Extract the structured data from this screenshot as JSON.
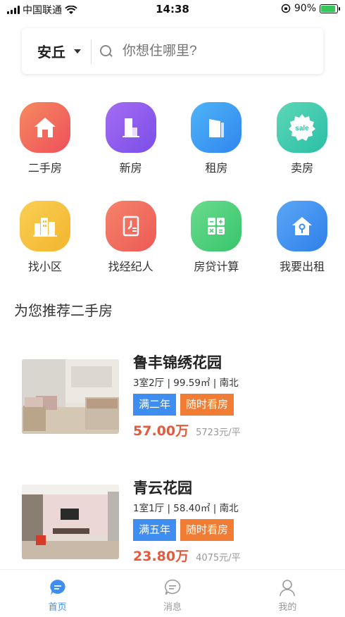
{
  "status": {
    "carrier": "中国联通",
    "time": "14:38",
    "battery": "90%"
  },
  "search": {
    "city": "安丘",
    "placeholder": "你想住哪里?"
  },
  "categories": [
    {
      "label": "二手房",
      "icon": "house-icon",
      "color": "#f0645a"
    },
    {
      "label": "新房",
      "icon": "building-icon",
      "color": "#8c5cf0"
    },
    {
      "label": "租房",
      "icon": "rent-building-icon",
      "color": "#3d9cf5"
    },
    {
      "label": "卖房",
      "icon": "sale-badge-icon",
      "color": "#38c9b0"
    },
    {
      "label": "找小区",
      "icon": "community-icon",
      "color": "#f5c040"
    },
    {
      "label": "找经纪人",
      "icon": "agent-icon",
      "color": "#f06a5a"
    },
    {
      "label": "房贷计算",
      "icon": "calculator-icon",
      "color": "#4ccf78"
    },
    {
      "label": "我要出租",
      "icon": "house-key-icon",
      "color": "#3d8ef0"
    }
  ],
  "section_title": "为您推荐二手房",
  "listings": [
    {
      "title": "鲁丰锦绣花园",
      "spec": "3室2厅 | 99.59㎡ | 南北",
      "tags": [
        "满二年",
        "随时看房"
      ],
      "price": "57.00万",
      "unit_price": "5723元/平"
    },
    {
      "title": "青云花园",
      "spec": "1室1厅 | 58.40㎡ | 南北",
      "tags": [
        "满五年",
        "随时看房"
      ],
      "price": "23.80万",
      "unit_price": "4075元/平"
    }
  ],
  "tabs": [
    {
      "label": "首页",
      "icon": "home-chat-icon",
      "active": true
    },
    {
      "label": "消息",
      "icon": "message-icon",
      "active": false
    },
    {
      "label": "我的",
      "icon": "profile-icon",
      "active": false
    }
  ],
  "colors": {
    "accent": "#3d8ef0",
    "price": "#e55a3c",
    "tag_blue": "#3d8ef0",
    "tag_orange": "#f07d33"
  }
}
